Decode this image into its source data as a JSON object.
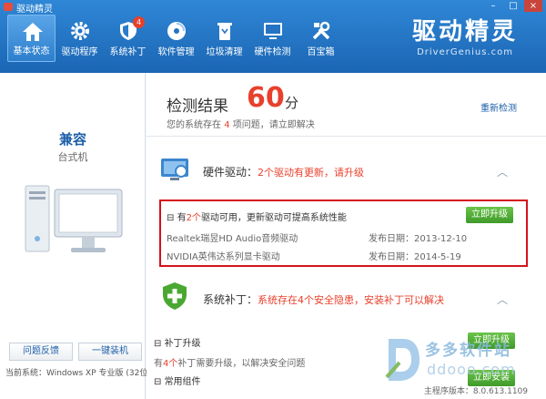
{
  "window": {
    "title": "驱动精灵",
    "controls": [
      "–",
      "□",
      "×"
    ]
  },
  "nav": [
    {
      "label": "基本状态",
      "icon": "home-icon",
      "active": true
    },
    {
      "label": "驱动程序",
      "icon": "gear-icon"
    },
    {
      "label": "系统补丁",
      "icon": "shield-icon",
      "badge": "4"
    },
    {
      "label": "软件管理",
      "icon": "disc-icon"
    },
    {
      "label": "垃圾清理",
      "icon": "trash-icon"
    },
    {
      "label": "硬件检测",
      "icon": "monitor-icon"
    },
    {
      "label": "百宝箱",
      "icon": "tools-icon"
    }
  ],
  "brand": {
    "name": "驱动精灵",
    "url": "DriverGenius.com"
  },
  "left": {
    "pc_name": "兼容",
    "pc_type": "台式机",
    "feedback_button": "问题反馈",
    "install_button": "一键装机",
    "system_label": "当前系统：",
    "system_value": "Windows XP 专业版 (32位)"
  },
  "score": {
    "title": "检测结果",
    "value": "60",
    "unit": "分",
    "desc_prefix": "您的系统存在",
    "issue_count": "4",
    "desc_suffix": "项问题，请立即解决",
    "recheck": "重新检测"
  },
  "hardware": {
    "name": "硬件驱动：",
    "status": "2个驱动有更新，请升级",
    "head_prefix": "有",
    "head_count": "2个",
    "head_suffix": "驱动可用，更新驱动可提高系统性能",
    "upgrade_button": "立即升级",
    "drivers": [
      {
        "name": "Realtek瑞昱HD Audio音频驱动",
        "date": "发布日期：2013-12-10"
      },
      {
        "name": "NVIDIA英伟达系列显卡驱动",
        "date": "发布日期：2014-5-19"
      }
    ]
  },
  "patch": {
    "name": "系统补丁：",
    "status": "系统存在4个安全隐患，安装补丁可以解决",
    "sub1": "补丁升级",
    "desc_prefix": "有",
    "desc_count": "4个",
    "desc_suffix": "补丁需要升级，以解决安全问题",
    "upgrade_button": "立即升级",
    "sub2": "常用组件",
    "install_button": "立即安装"
  },
  "watermark": {
    "cn": "多多软件站",
    "en": "ddooo.com"
  },
  "version": "主程序版本：8.0.613.1109",
  "colors": {
    "accent": "#1d5fa8",
    "alert": "#e8402c",
    "highlight_border": "#d4121a",
    "green": "#4aa832"
  }
}
